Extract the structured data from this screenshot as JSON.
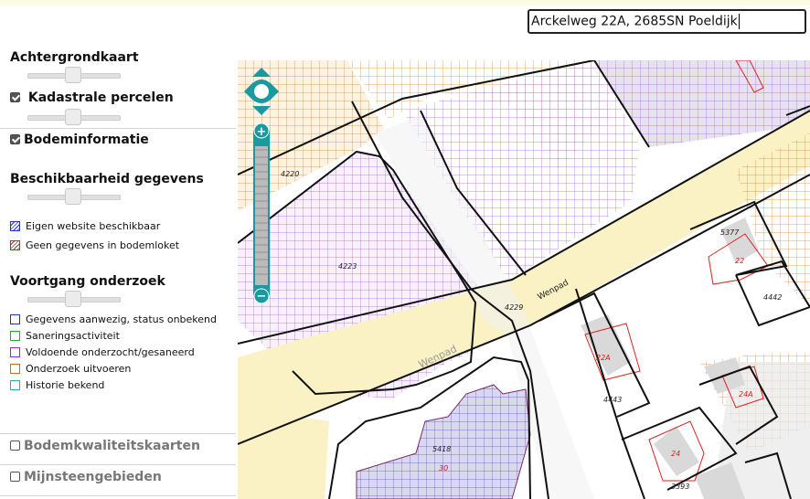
{
  "search": {
    "value": "Arckelweg 22A, 2685SN Poeldijk"
  },
  "panel": {
    "achtergrondkaart": "Achtergrondkaart",
    "kadastrale": "Kadastrale percelen",
    "bodeminformatie": "Bodeminformatie",
    "beschikbaarheid": "Beschikbaarheid gegevens",
    "beschikbaarheid_items": [
      {
        "label": "Eigen website beschikbaar",
        "color": "#2233cc"
      },
      {
        "label": "Geen gegevens in bodemloket",
        "color": "#cc2222"
      }
    ],
    "voortgang": "Voortgang onderzoek",
    "voortgang_items": [
      {
        "label": "Gegevens aanwezig, status onbekend",
        "color": "#2233aa"
      },
      {
        "label": "Saneringsactiviteit",
        "color": "#22aa33"
      },
      {
        "label": "Voldoende onderzocht/gesaneerd",
        "color": "#8a2be2"
      },
      {
        "label": "Onderzoek uitvoeren",
        "color": "#d2691e"
      },
      {
        "label": "Historie bekend",
        "color": "#20b2aa"
      }
    ],
    "bodemkwaliteit": "Bodemkwaliteitskaarten",
    "mijnsteen": "Mijnsteengebieden"
  },
  "map": {
    "parcels": [
      "4220",
      "4223",
      "4229",
      "5377",
      "22",
      "4442",
      "22A",
      "4443",
      "24A",
      "24",
      "3393",
      "5418",
      "30"
    ],
    "streets": [
      "Wenpad",
      "Wenpad"
    ]
  },
  "zoom": {
    "plus": "+",
    "minus": "−"
  }
}
